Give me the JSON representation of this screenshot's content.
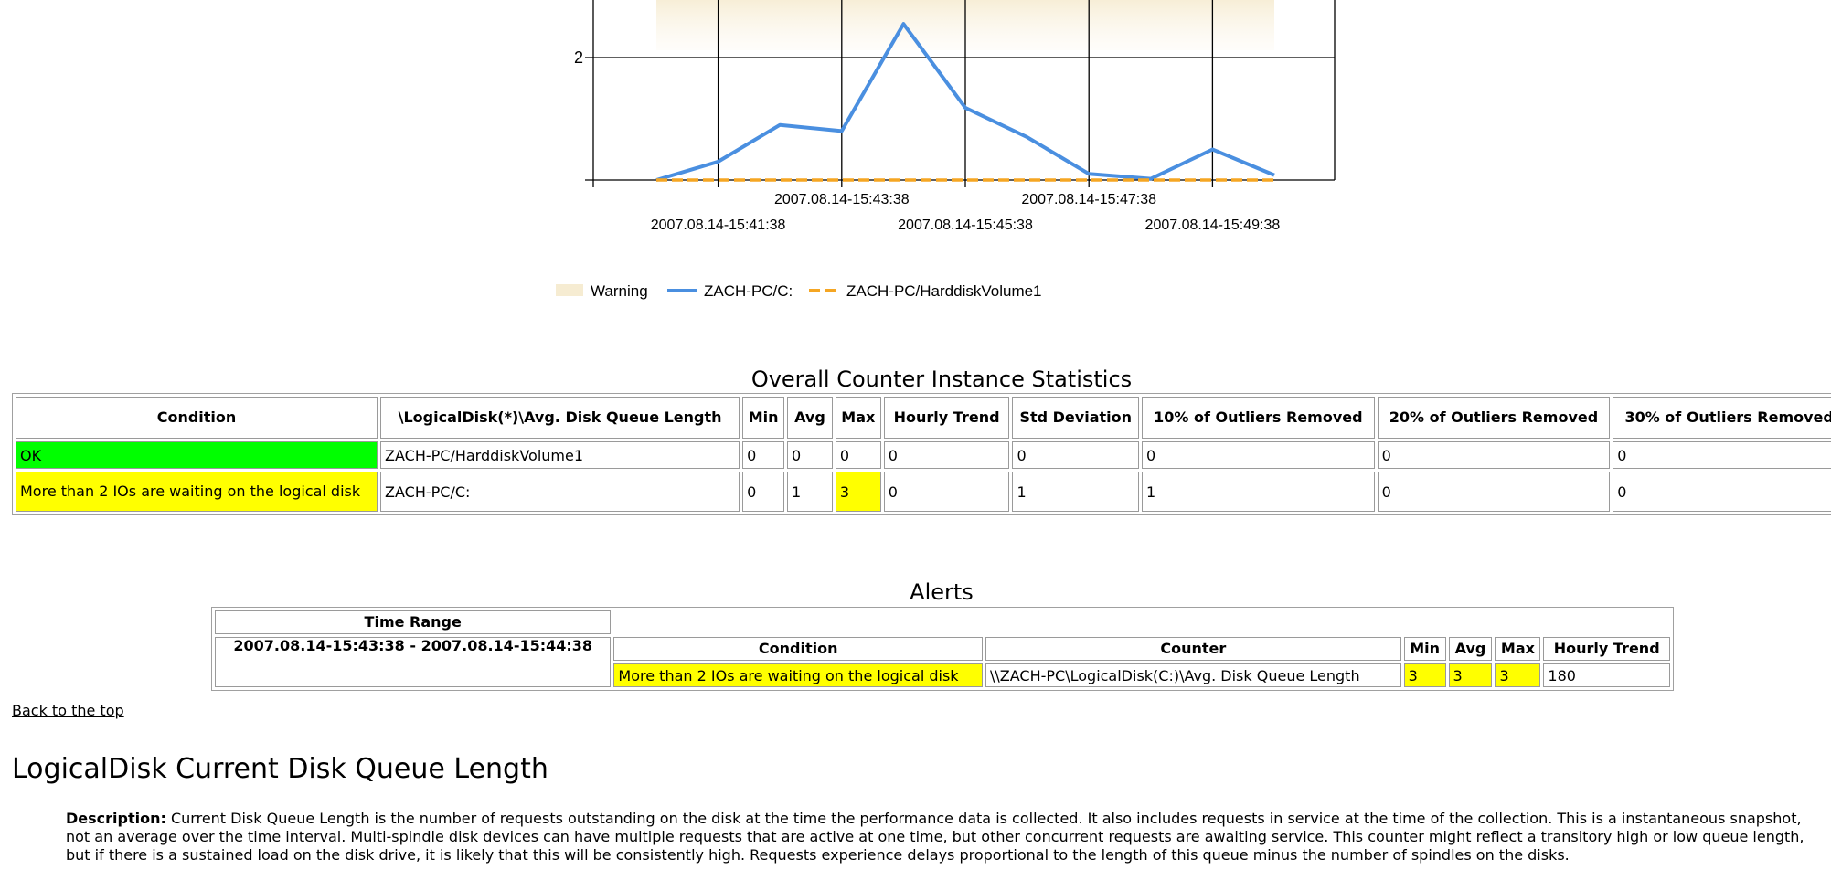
{
  "chart_data": {
    "type": "line",
    "x": [
      "2007.08.14-15:40:38",
      "2007.08.14-15:41:38",
      "2007.08.14-15:42:38",
      "2007.08.14-15:43:38",
      "2007.08.14-15:44:38",
      "2007.08.14-15:45:38",
      "2007.08.14-15:46:38",
      "2007.08.14-15:47:38",
      "2007.08.14-15:48:38",
      "2007.08.14-15:49:38",
      "2007.08.14-15:50:38"
    ],
    "x_tick_labels_upper": [
      "2007.08.14-15:43:38",
      "2007.08.14-15:47:38"
    ],
    "x_tick_labels_lower": [
      "2007.08.14-15:41:38",
      "2007.08.14-15:45:38",
      "2007.08.14-15:49:38"
    ],
    "y_tick_labels": [
      "2"
    ],
    "y_ticks": [
      2
    ],
    "ylim": [
      0,
      3
    ],
    "grid": true,
    "legend_placement": "bottom-center",
    "series": [
      {
        "name": "ZACH-PC/C:",
        "style": "solid",
        "color": "#4a8fe0",
        "values": [
          0.0,
          0.3,
          0.9,
          0.8,
          2.55,
          1.18,
          0.7,
          0.1,
          0.02,
          0.5,
          0.08
        ]
      },
      {
        "name": "ZACH-PC/HarddiskVolume1",
        "style": "dashed",
        "color": "#f5a623",
        "values": [
          0,
          0,
          0,
          0,
          0,
          0,
          0,
          0,
          0,
          0,
          0
        ]
      }
    ],
    "warning_band": {
      "name": "Warning",
      "color": "#f6ecd2"
    }
  },
  "overall": {
    "title": "Overall Counter Instance Statistics",
    "headers": [
      "Condition",
      "\\LogicalDisk(*)\\Avg. Disk Queue Length",
      "Min",
      "Avg",
      "Max",
      "Hourly Trend",
      "Std Deviation",
      "10% of Outliers Removed",
      "20% of Outliers Removed",
      "30% of Outliers Removed"
    ],
    "rows": [
      [
        "OK",
        "ZACH-PC/HarddiskVolume1",
        "0",
        "0",
        "0",
        "0",
        "0",
        "0",
        "0",
        "0"
      ],
      [
        "More than 2 IOs are waiting on the logical disk",
        "ZACH-PC/C:",
        "0",
        "1",
        "3",
        "0",
        "1",
        "1",
        "0",
        "0"
      ]
    ]
  },
  "alerts": {
    "title": "Alerts",
    "time_range_header": "Time Range",
    "time_range": "2007.08.14-15:43:38 - 2007.08.14-15:44:38",
    "headers": [
      "Condition",
      "Counter",
      "Min",
      "Avg",
      "Max",
      "Hourly Trend"
    ],
    "row": [
      "More than 2 IOs are waiting on the logical disk",
      "\\\\ZACH-PC\\LogicalDisk(C:)\\Avg. Disk Queue Length",
      "3",
      "3",
      "3",
      "180"
    ]
  },
  "back_to_top": "Back to the top",
  "section_heading": "LogicalDisk Current Disk Queue Length",
  "description_label": "Description:",
  "description_text": "Current Disk Queue Length is the number of requests outstanding on the disk at the time the performance data is collected. It also includes requests in service at the time of the collection. This is a instantaneous snapshot, not an average over the time interval. Multi-spindle disk devices can have multiple requests that are active at one time, but other concurrent requests are awaiting service. This counter might reflect a transitory high or low queue length, but if there is a sustained load on the disk drive, it is likely that this will be consistently high. Requests experience delays proportional to the length of this queue minus the number of spindles on the disks.",
  "colors": {
    "ok": "#00ff00",
    "alert": "#ffff00"
  }
}
